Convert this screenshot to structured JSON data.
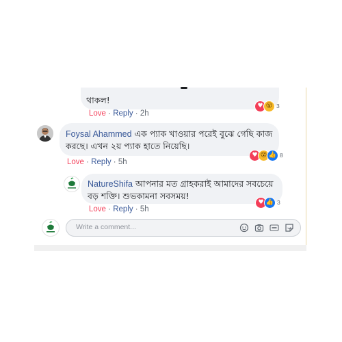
{
  "comments": {
    "top": {
      "text": "থাকল!",
      "love_label": "Love",
      "reply_label": "Reply",
      "time": "2h",
      "reactions": [
        "heart-icon",
        "wow-icon"
      ],
      "reaction_count": "3"
    },
    "foysal": {
      "name": "Foysal Ahammed",
      "text": "এক প্যাক খাওয়ার পরেই বুঝে গেছি কাজ করছে। এখন ২য় প্যাক হাতে নিয়েছি।",
      "love_label": "Love",
      "reply_label": "Reply",
      "time": "5h",
      "reactions": [
        "heart-icon",
        "wow-icon",
        "like-icon"
      ],
      "reaction_count": "8"
    },
    "natureshifa": {
      "name": "NatureShifa",
      "text": "আপনার মত গ্রাহকরাই আমাদের সবচেয়ে বড় শক্তি। শুভকামনা সবসময়!",
      "love_label": "Love",
      "reply_label": "Reply",
      "time": "5h",
      "reactions": [
        "heart-icon",
        "like-icon"
      ],
      "reaction_count": "3"
    }
  },
  "composer": {
    "placeholder": "Write a comment..."
  },
  "separator": "·",
  "colors": {
    "link": "#385898",
    "love": "#f33e58",
    "like": "#1877f2",
    "bubble": "#f0f2f5"
  }
}
